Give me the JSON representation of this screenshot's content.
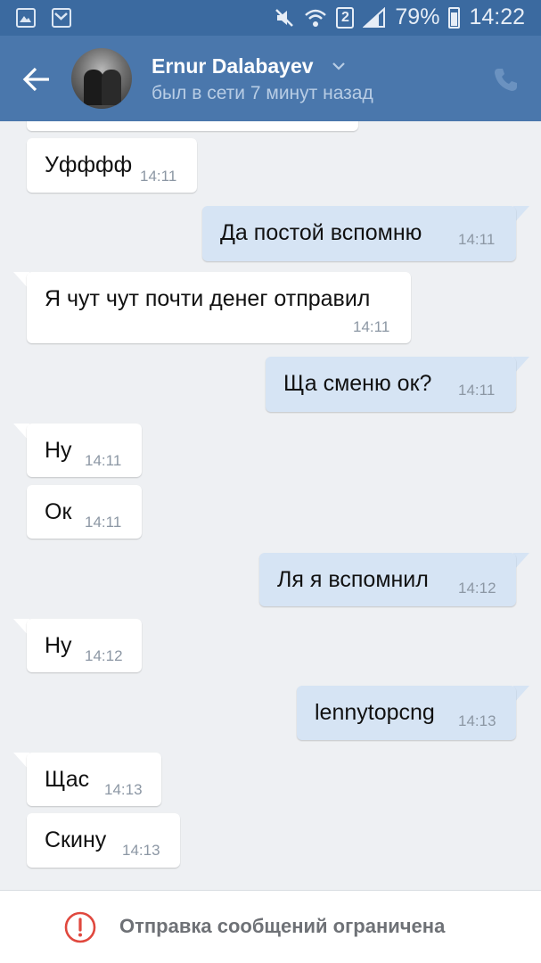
{
  "status_bar": {
    "battery": "79%",
    "clock": "14:22",
    "sim": "2",
    "icons": [
      "gallery-icon",
      "email-icon",
      "mute-icon",
      "wifi-icon",
      "signal-icon",
      "battery-icon"
    ]
  },
  "header": {
    "name": "Ernur Dalabayev",
    "status": "был в сети 7 минут назад",
    "icons": [
      "back-arrow-icon",
      "chevron-down-icon",
      "phone-icon"
    ],
    "colors": {
      "status_bar": "#3b6aa0",
      "toolbar": "#4a77ac"
    }
  },
  "messages": [
    {
      "dir": "in",
      "text": "Уфффф",
      "time": "14:11"
    },
    {
      "dir": "out",
      "text": "Да постой вспомню",
      "time": "14:11"
    },
    {
      "dir": "in",
      "text": "Я чут чут почти денег отправил",
      "time": "14:11"
    },
    {
      "dir": "out",
      "text": "Ща сменю ок?",
      "time": "14:11"
    },
    {
      "dir": "in",
      "text": "Ну",
      "time": "14:11"
    },
    {
      "dir": "in",
      "text": "Ок",
      "time": "14:11"
    },
    {
      "dir": "out",
      "text": "Ля я вспомнил",
      "time": "14:12"
    },
    {
      "dir": "in",
      "text": "Ну",
      "time": "14:12"
    },
    {
      "dir": "out",
      "text": "lennytopcng",
      "time": "14:13"
    },
    {
      "dir": "in",
      "text": "Щас",
      "time": "14:13"
    },
    {
      "dir": "in",
      "text": "Скину",
      "time": "14:13"
    }
  ],
  "bottom": {
    "restriction": "Отправка сообщений ограничена",
    "icon": "exclamation-circle-icon",
    "icon_color": "#e0483e"
  }
}
